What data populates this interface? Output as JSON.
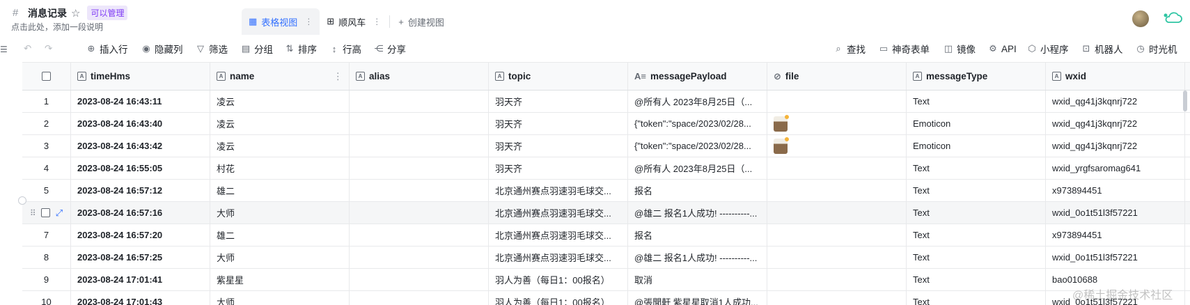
{
  "app": {
    "title": "消息记录",
    "permission": "可以管理",
    "description": "点击此处，添加一段说明"
  },
  "views": {
    "tabs": [
      {
        "label": "表格视图",
        "active": true
      },
      {
        "label": "顺风车",
        "active": false
      }
    ],
    "create_label": "创建视图"
  },
  "toolbar": {
    "left": [
      "插入行",
      "隐藏列",
      "筛选",
      "分组",
      "排序",
      "行高",
      "分享"
    ],
    "right": [
      "查找",
      "神奇表单",
      "镜像",
      "API",
      "小程序",
      "机器人",
      "时光机"
    ]
  },
  "columns": [
    "timeHms",
    "name",
    "alias",
    "topic",
    "messagePayload",
    "file",
    "messageType",
    "wxid"
  ],
  "rows": [
    {
      "num": "1",
      "timeHms": "2023-08-24 16:43:11",
      "name": "凌云",
      "alias": "",
      "topic": "羽天齐",
      "messagePayload": "@所有人 2023年8月25日（...",
      "file": false,
      "messageType": "Text",
      "wxid": "wxid_qg41j3kqnrj722"
    },
    {
      "num": "2",
      "timeHms": "2023-08-24 16:43:40",
      "name": "凌云",
      "alias": "",
      "topic": "羽天齐",
      "messagePayload": "{\"token\":\"space/2023/02/28...",
      "file": true,
      "messageType": "Emoticon",
      "wxid": "wxid_qg41j3kqnrj722"
    },
    {
      "num": "3",
      "timeHms": "2023-08-24 16:43:42",
      "name": "凌云",
      "alias": "",
      "topic": "羽天齐",
      "messagePayload": "{\"token\":\"space/2023/02/28...",
      "file": true,
      "messageType": "Emoticon",
      "wxid": "wxid_qg41j3kqnrj722"
    },
    {
      "num": "4",
      "timeHms": "2023-08-24 16:55:05",
      "name": "村花",
      "alias": "",
      "topic": "羽天齐",
      "messagePayload": "@所有人 2023年8月25日（...",
      "file": false,
      "messageType": "Text",
      "wxid": "wxid_yrgfsaromag641"
    },
    {
      "num": "5",
      "timeHms": "2023-08-24 16:57:12",
      "name": "雄二",
      "alias": "",
      "topic": "北京通州赛点羽速羽毛球交...",
      "messagePayload": "报名",
      "file": false,
      "messageType": "Text",
      "wxid": "x973894451"
    },
    {
      "num": "6",
      "timeHms": "2023-08-24 16:57:16",
      "name": "大师",
      "alias": "",
      "topic": "北京通州赛点羽速羽毛球交...",
      "messagePayload": "@雄二 报名1人成功! ----------...",
      "file": false,
      "messageType": "Text",
      "wxid": "wxid_0o1t51l3f57221",
      "hover": true
    },
    {
      "num": "7",
      "timeHms": "2023-08-24 16:57:20",
      "name": "雄二",
      "alias": "",
      "topic": "北京通州赛点羽速羽毛球交...",
      "messagePayload": "报名",
      "file": false,
      "messageType": "Text",
      "wxid": "x973894451"
    },
    {
      "num": "8",
      "timeHms": "2023-08-24 16:57:25",
      "name": "大师",
      "alias": "",
      "topic": "北京通州赛点羽速羽毛球交...",
      "messagePayload": "@雄二 报名1人成功! ----------...",
      "file": false,
      "messageType": "Text",
      "wxid": "wxid_0o1t51l3f57221"
    },
    {
      "num": "9",
      "timeHms": "2023-08-24 17:01:41",
      "name": "紫星星",
      "alias": "",
      "topic": "羽人为善（每日1：00报名）",
      "messagePayload": "取消",
      "file": false,
      "messageType": "Text",
      "wxid": "bao010688"
    },
    {
      "num": "10",
      "timeHms": "2023-08-24 17:01:43",
      "name": "大师",
      "alias": "",
      "topic": "羽人为善（每日1：00报名）",
      "messagePayload": "@張聞軒 紫星星取消1人成功...",
      "file": false,
      "messageType": "Text",
      "wxid": "wxid_0o1t51l3f57221"
    }
  ],
  "watermark": "@稀土掘金技术社区",
  "colors": {
    "accent": "#3370ff",
    "permission_bg": "#ede6fb",
    "permission_text": "#7f3bf5"
  },
  "icons": {
    "title": "hash-icon",
    "favorite": "star-icon",
    "grid_view": "grid-view-icon",
    "gallery_view": "gallery-view-icon"
  }
}
